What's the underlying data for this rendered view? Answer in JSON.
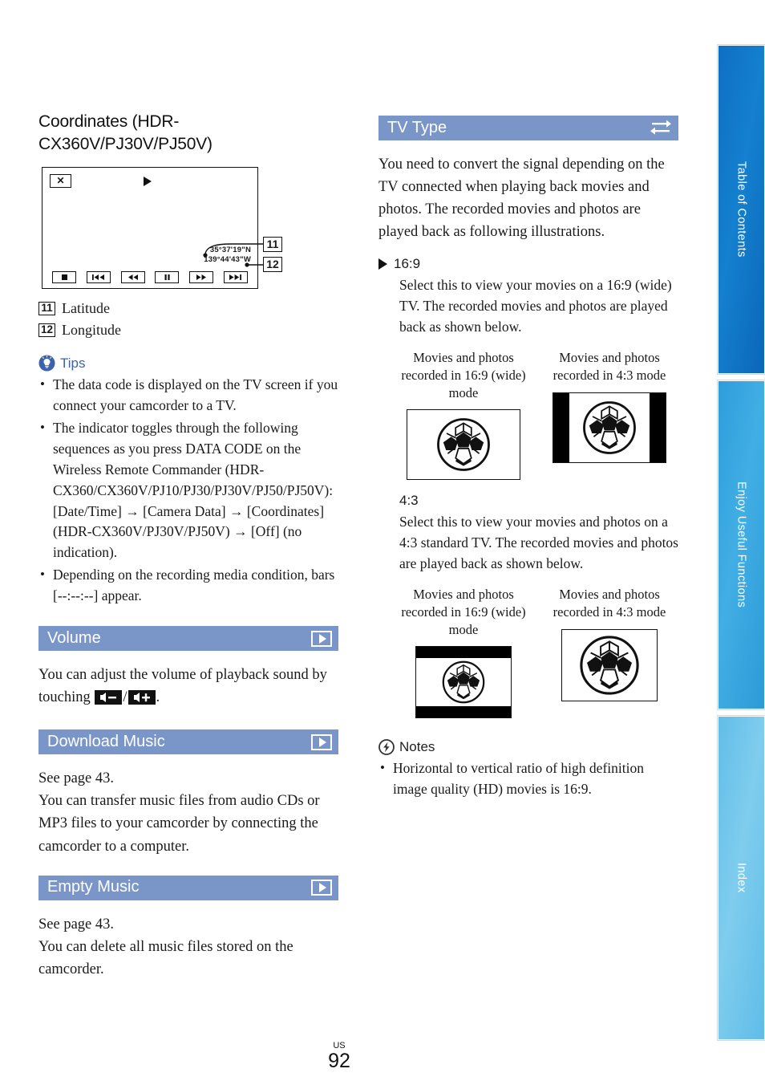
{
  "page": {
    "number": "92",
    "region_code": "US"
  },
  "left_column": {
    "heading": "Coordinates (HDR-CX360V/PJ30V/PJ50V)",
    "figure": {
      "close_label": "✕",
      "latitude_value": "35°37'19\"N",
      "longitude_value": "139°44'43\"W",
      "callout_11": "11",
      "callout_12": "12",
      "buttons": [
        "stop",
        "previous",
        "rewind",
        "pause",
        "fast-forward",
        "next"
      ]
    },
    "legend": [
      {
        "num": "11",
        "label": "Latitude"
      },
      {
        "num": "12",
        "label": "Longitude"
      }
    ],
    "tips": {
      "label": "Tips",
      "items": [
        "The data code is displayed on the TV screen if you connect your camcorder to a TV.",
        "The indicator toggles through the following sequences as you press DATA CODE on the Wireless Remote Commander (HDR-CX360/CX360V/PJ10/PJ30/PJ30V/PJ50/PJ50V): [Date/Time] → [Camera Data] → [Coordinates] (HDR-CX360V/PJ30V/PJ50V) → [Off] (no indication).",
        "Depending on the recording media condition, bars [--:--:--] appear."
      ]
    },
    "sections": [
      {
        "title": "Volume",
        "icon": "play-icon",
        "body_before_icons": "You can adjust the volume of playback sound by touching",
        "icon_vol_down": "volume-down-icon",
        "icon_vol_up": "volume-up-icon",
        "body_after_icons": "."
      },
      {
        "title": "Download Music",
        "icon": "play-icon",
        "body": "See page 43.\nYou can transfer music files from audio CDs or MP3 files to your camcorder by connecting the camcorder to a computer."
      },
      {
        "title": "Empty Music",
        "icon": "play-icon",
        "body": "See page 43.\nYou can delete all music files stored on the camcorder."
      }
    ]
  },
  "right_column": {
    "section": {
      "title": "TV Type",
      "icon": "swap-arrows-icon"
    },
    "intro": "You need to convert the signal depending on the TV connected when playing back movies and photos. The recorded movies and photos are played back as following illustrations.",
    "options": [
      {
        "name": "16:9",
        "marker": "triangle",
        "description": "Select this to view your movies on a 16:9 (wide) TV. The recorded movies and photos are played back as shown below.",
        "figures": [
          {
            "caption": "Movies and photos recorded in 16:9 (wide) mode",
            "frame": "wide-full"
          },
          {
            "caption": "Movies and photos recorded in 4:3 mode",
            "frame": "wide-pillarbox"
          }
        ]
      },
      {
        "name": "4:3",
        "marker": "none",
        "description": "Select this to view your movies and photos on a 4:3 standard TV. The recorded movies and photos are played back as shown below.",
        "figures": [
          {
            "caption": "Movies and photos recorded in 16:9 (wide) mode",
            "frame": "standard-letterbox"
          },
          {
            "caption": "Movies and photos recorded in 4:3 mode",
            "frame": "standard-full"
          }
        ]
      }
    ],
    "notes": {
      "label": "Notes",
      "items": [
        "Horizontal to vertical ratio of high definition image quality (HD) movies is 16:9."
      ]
    }
  },
  "side_tabs": [
    {
      "label": "Table of Contents",
      "color": "#0e6fc4"
    },
    {
      "label": "Enjoy Useful Functions",
      "color": "#2e9ddb"
    },
    {
      "label": "Index",
      "color": "#61bde8"
    }
  ],
  "colors": {
    "section_bar": "#7a96c8",
    "tips_accent": "#3b63ad",
    "text": "#1a1a1a"
  }
}
